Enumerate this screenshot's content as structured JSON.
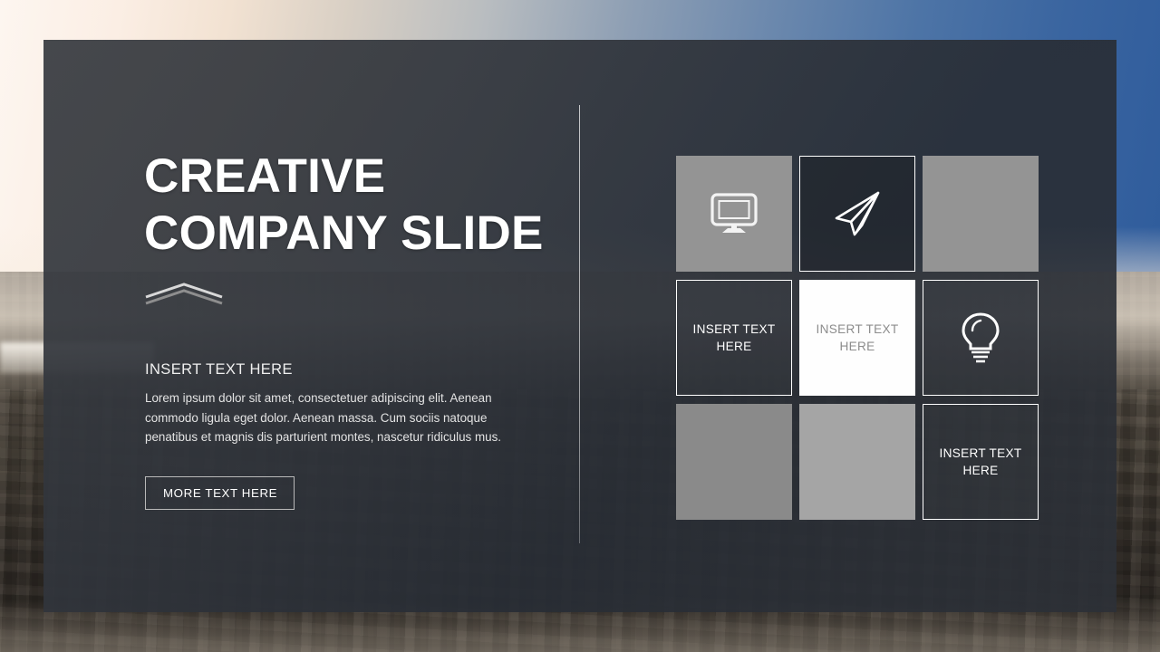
{
  "slide": {
    "title_lines": [
      "CREATIVE",
      "COMPANY SLIDE"
    ],
    "subheading": "INSERT TEXT HERE",
    "body": "Lorem ipsum dolor sit amet, consectetuer adipiscing elit. Aenean commodo ligula eget dolor. Aenean massa. Cum sociis natoque penatibus et magnis dis parturient montes, nascetur ridiculus mus.",
    "cta_label": "MORE TEXT HERE"
  },
  "colors": {
    "panel": "#2f343c",
    "tile_gray_mid": "#949494",
    "tile_gray_dark": "#8a8a8a",
    "tile_gray_light": "#a5a5a5",
    "tile_white": "#fefefe",
    "white_tile_text": "#8c8c8c",
    "accent_outline": "#ffffff",
    "sky_blue": "#36609f"
  },
  "grid": {
    "tiles": [
      {
        "id": "tile-1",
        "style": "solid-mid",
        "icon": "monitor-icon",
        "label": ""
      },
      {
        "id": "tile-2",
        "style": "outline-dark",
        "icon": "paper-plane-icon",
        "label": ""
      },
      {
        "id": "tile-3",
        "style": "solid-mid",
        "icon": "",
        "label": ""
      },
      {
        "id": "tile-4",
        "style": "outline",
        "icon": "",
        "label": "INSERT TEXT HERE"
      },
      {
        "id": "tile-5",
        "style": "white",
        "icon": "",
        "label": "INSERT TEXT HERE"
      },
      {
        "id": "tile-6",
        "style": "outline",
        "icon": "lightbulb-icon",
        "label": ""
      },
      {
        "id": "tile-7",
        "style": "solid-dark",
        "icon": "",
        "label": ""
      },
      {
        "id": "tile-8",
        "style": "solid-light",
        "icon": "",
        "label": ""
      },
      {
        "id": "tile-9",
        "style": "outline",
        "icon": "",
        "label": "INSERT TEXT HERE"
      }
    ]
  }
}
